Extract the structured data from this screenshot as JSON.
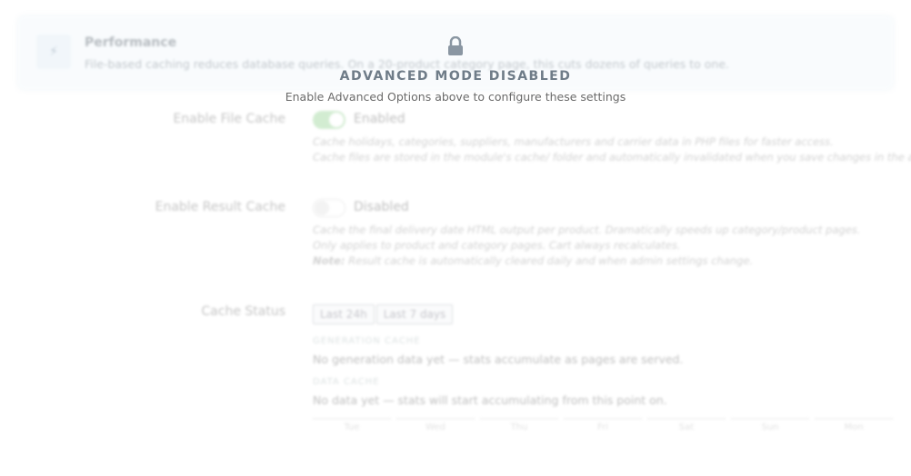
{
  "banner": {
    "icon": "bolt-icon",
    "title": "Performance",
    "text": "File-based caching reduces database queries. On a 20-product category page, this cuts dozens of queries to one."
  },
  "file_cache": {
    "label": "Enable File Cache",
    "state": "Enabled",
    "help1": "Cache holidays, categories, suppliers, manufacturers and carrier data in PHP files for faster access.",
    "help2": "Cache files are stored in the module's cache/ folder and automatically invalidated when you save changes in the admin."
  },
  "result_cache": {
    "label": "Enable Result Cache",
    "state": "Disabled",
    "help1": "Cache the final delivery date HTML output per product. Dramatically speeds up category/product pages.",
    "help2": "Only applies to product and category pages. Cart always recalculates.",
    "note_label": "Note:",
    "note_text": " Result cache is automatically cleared daily and when admin settings change."
  },
  "cache_status": {
    "label": "Cache Status",
    "buttons": [
      "Last 24h",
      "Last 7 days"
    ],
    "generation_heading": "GENERATION CACHE",
    "generation_text": "No generation data yet — stats accumulate as pages are served.",
    "data_heading": "DATA CACHE",
    "data_text": "No data yet — stats will start accumulating from this point on.",
    "days": [
      "Tue",
      "Wed",
      "Thu",
      "Fri",
      "Sat",
      "Sun",
      "Mon"
    ]
  },
  "overlay": {
    "icon": "lock-icon",
    "title": "ADVANCED MODE DISABLED",
    "subtitle": "Enable Advanced Options above to configure these settings"
  },
  "colors": {
    "toggle_on": "#7cc97a",
    "banner_bg": "#eef6fc",
    "overlay_text": "#6f7c88"
  }
}
